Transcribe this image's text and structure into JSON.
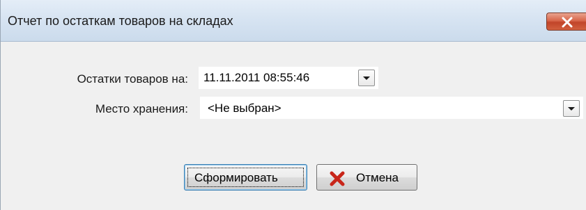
{
  "window": {
    "title": "Отчет по остаткам товаров на складах",
    "close_label": "×"
  },
  "form": {
    "date_label": "Остатки товаров на:",
    "date_value": "11.11.2011 08:55:46",
    "store_label": "Место хранения:",
    "store_value": "<Не выбран>"
  },
  "buttons": {
    "generate_label": "Сформировать",
    "cancel_label": "Отмена"
  },
  "colors": {
    "cancel_icon": "#c8261a",
    "close_button": "#d8664a"
  },
  "icons": {
    "close": "close-icon",
    "cancel": "cancel-x-icon",
    "dropdown": "chevron-down-icon"
  }
}
